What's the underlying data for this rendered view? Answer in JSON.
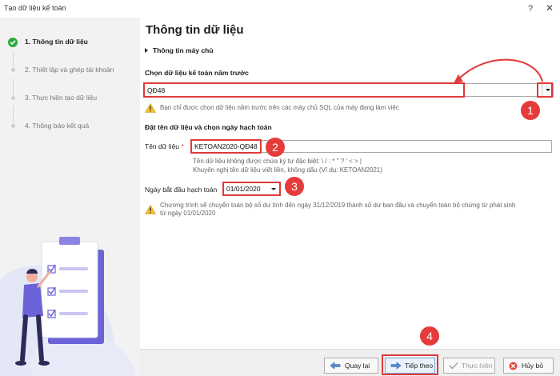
{
  "window": {
    "title": "Tạo dữ liệu kế toán",
    "help": "?",
    "close": "✕"
  },
  "sidebar": {
    "steps": [
      {
        "label": "1. Thông tin dữ liệu",
        "state": "done"
      },
      {
        "label": "2. Thiết lập và ghép tài khoản",
        "state": "pending"
      },
      {
        "label": "3. Thực hiện tạo dữ liệu",
        "state": "pending"
      },
      {
        "label": "4. Thông  báo kết quả",
        "state": "pending"
      }
    ]
  },
  "main": {
    "heading": "Thông tin dữ liệu",
    "server_section": "Thông tin máy chủ",
    "prev_data": {
      "label": "Chọn dữ liệu kế toán năm trước",
      "value": "QĐ48",
      "note": "Bạn chỉ được chọn dữ liệu năm trước trên các máy chủ SQL của máy đang làm việc"
    },
    "naming": {
      "label": "Đặt tên dữ liệu và chọn ngày hạch toán",
      "name_label": "Tên dữ liệu",
      "required_mark": "*",
      "name_value": "KETOAN2020-QĐ48",
      "name_hint_1": "Tên dữ liệu không được chứa ký tự đặc biệt: \\ / : * \" ? ' < > |",
      "name_hint_2": "Khuyến nghị tên dữ liệu viết liền, không dấu (Ví dụ: KETOAN2021)",
      "start_date_label": "Ngày bắt đầu hạch toán",
      "start_date_value": "01/01/2020",
      "date_note_1": "Chương trình sẽ chuyển toàn bộ số dư tính đến ngày 31/12/2019 thành số dư ban đầu và chuyển toàn bộ chứng từ phát sinh",
      "date_note_2": "từ ngày 01/01/2020"
    }
  },
  "annotations": {
    "badge1": "1",
    "badge2": "2",
    "badge3": "3",
    "badge4": "4",
    "highlight_color": "#e03a3a"
  },
  "footer": {
    "back": "Quay lại",
    "next": "Tiếp theo",
    "execute": "Thực hiện",
    "cancel": "Hủy bỏ"
  }
}
